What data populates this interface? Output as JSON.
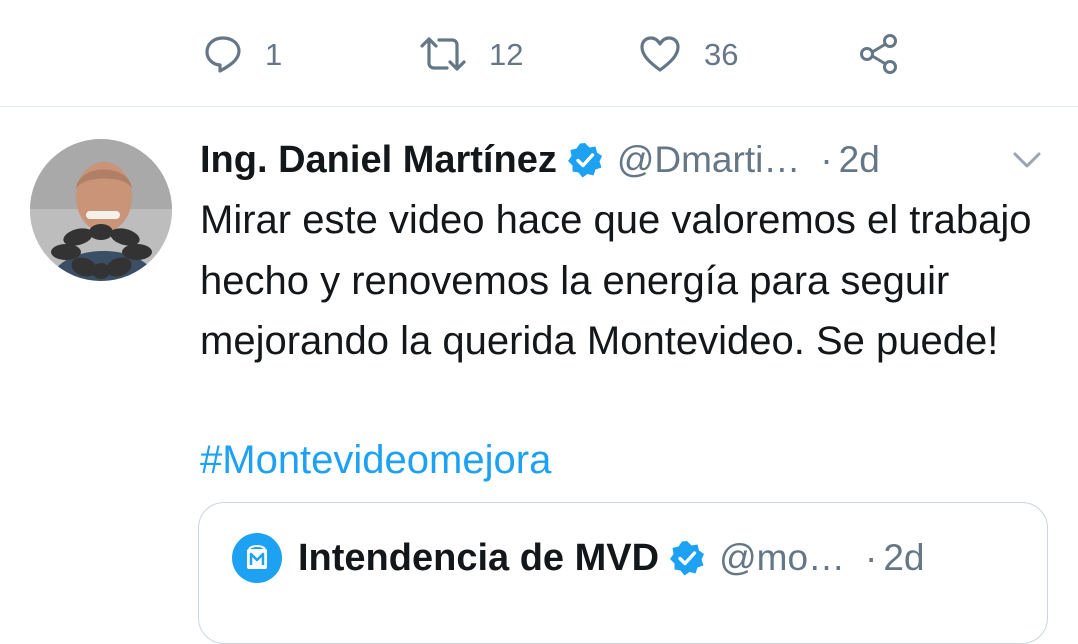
{
  "prev_tweet_actions": {
    "reply_count": "1",
    "retweet_count": "12",
    "like_count": "36"
  },
  "tweet": {
    "author_name": "Ing. Daniel Martínez",
    "handle": "@Dmarti…",
    "separator": "·",
    "time": "2d",
    "text": "Mirar este video hace que valoremos el trabajo hecho y renovemos la energía para seguir mejorando la querida Montevideo. Se puede!",
    "hashtag": "#Montevideomejora"
  },
  "quoted_tweet": {
    "author_name": "Intendencia de MVD",
    "handle": "@mo…",
    "separator": "·",
    "time": "2d"
  },
  "colors": {
    "accent": "#1da1f2",
    "secondary_text": "#657786",
    "primary_text": "#14171a",
    "divider": "#e1e8ed"
  },
  "icons": [
    "reply-icon",
    "retweet-icon",
    "like-icon",
    "share-icon",
    "verified-badge-icon",
    "caret-down-icon"
  ]
}
